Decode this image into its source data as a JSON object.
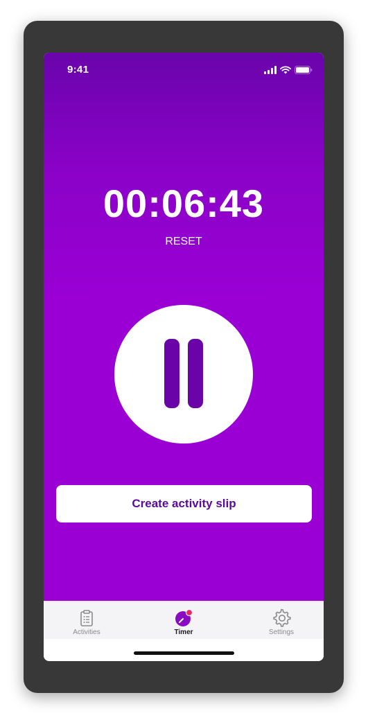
{
  "status_bar": {
    "time": "9:41"
  },
  "timer": {
    "elapsed": "00:06:43",
    "reset_label": "RESET",
    "state": "running"
  },
  "actions": {
    "create_slip_label": "Create activity slip"
  },
  "tab_bar": {
    "tabs": [
      {
        "label": "Activities",
        "icon": "clipboard-icon",
        "active": false
      },
      {
        "label": "Timer",
        "icon": "timer-icon",
        "active": true
      },
      {
        "label": "Settings",
        "icon": "gear-icon",
        "active": false
      }
    ]
  },
  "colors": {
    "background_top": "#6a04ac",
    "background": "#9a00d4",
    "pause_glyph": "#6a03a8",
    "button_text": "#5a0a99",
    "badge": "#e8246a"
  }
}
